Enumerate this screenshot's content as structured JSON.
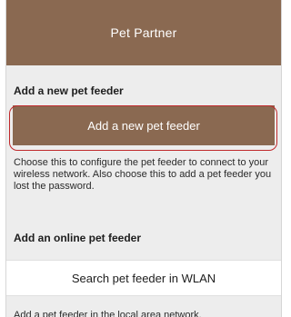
{
  "app_bar": {
    "title": "Pet Partner"
  },
  "section_new": {
    "title": "Add a new pet feeder",
    "button_label": "Add a new pet feeder",
    "description": "Choose this to configure the pet feeder to connect to your wireless network. Also choose this to add a pet feeder you lost the password."
  },
  "section_online": {
    "title": "Add an online pet feeder",
    "button_label": "Search pet feeder in WLAN",
    "description": "Add a pet feeder in the local area network."
  },
  "colors": {
    "brand_brown": "#8a6951",
    "highlight_ring": "#c0282b",
    "background": "#ededed"
  }
}
